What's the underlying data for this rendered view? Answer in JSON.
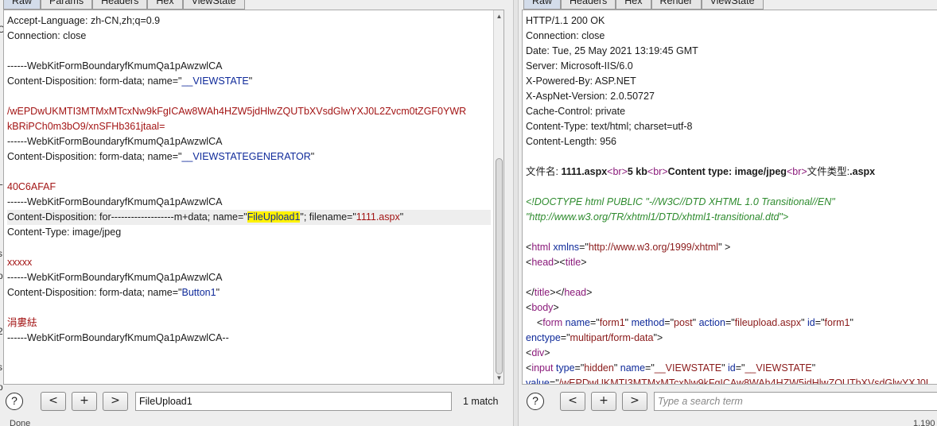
{
  "left": {
    "tabs": [
      "Raw",
      "Params",
      "Headers",
      "Hex",
      "ViewState"
    ],
    "lines": [
      [
        {
          "t": "Accept-Language: zh-CN,zh;q=0.9",
          "c": "k"
        }
      ],
      [
        {
          "t": "Connection: close",
          "c": "k"
        }
      ],
      [],
      [
        {
          "t": "------WebKitFormBoundaryfKmumQa1pAwzwlCA",
          "c": "k"
        }
      ],
      [
        {
          "t": "Content-Disposition: form-data; name=\"",
          "c": "k"
        },
        {
          "t": "__VIEWSTATE",
          "c": "b"
        },
        {
          "t": "\"",
          "c": "k"
        }
      ],
      [],
      [
        {
          "t": "/wEPDwUKMTI3MTMxMTcxNw9kFgICAw8WAh4HZW5jdHlwZQUTbXVsdGlwYXJ0L2Zvcm0tZGF0YWR",
          "c": "v"
        }
      ],
      [
        {
          "t": "kBRiPCh0m3bO9/xnSFHb361jtaal=",
          "c": "v"
        }
      ],
      [
        {
          "t": "------WebKitFormBoundaryfKmumQa1pAwzwlCA",
          "c": "k"
        }
      ],
      [
        {
          "t": "Content-Disposition: form-data; name=\"",
          "c": "k"
        },
        {
          "t": "__VIEWSTATEGENERATOR",
          "c": "b"
        },
        {
          "t": "\"",
          "c": "k"
        }
      ],
      [],
      [
        {
          "t": "40C6AFAF",
          "c": "v"
        }
      ],
      [
        {
          "t": "------WebKitFormBoundaryfKmumQa1pAwzwlCA",
          "c": "k"
        }
      ],
      [
        {
          "t": "Content-Disposition: for-------------------m+data; name=\"",
          "c": "k"
        },
        {
          "t": "FileUpload1",
          "c": "b mark"
        },
        {
          "t": "\"; filename=\"",
          "c": "k"
        },
        {
          "t": "1111.aspx",
          "c": "v"
        },
        {
          "t": "\"",
          "c": "k"
        }
      ],
      [
        {
          "t": "Content-Type: image/jpeg",
          "c": "k"
        }
      ],
      [],
      [
        {
          "t": "xxxxx",
          "c": "v"
        }
      ],
      [
        {
          "t": "------WebKitFormBoundaryfKmumQa1pAwzwlCA",
          "c": "k"
        }
      ],
      [
        {
          "t": "Content-Disposition: form-data; name=\"",
          "c": "k"
        },
        {
          "t": "Button1",
          "c": "b"
        },
        {
          "t": "\"",
          "c": "k"
        }
      ],
      [],
      [
        {
          "t": "涓婁紶",
          "c": "v"
        }
      ],
      [
        {
          "t": "------WebKitFormBoundaryfKmumQa1pAwzwlCA--",
          "c": "k"
        }
      ]
    ],
    "highlight_line": 13,
    "search": {
      "value": "FileUpload1",
      "match_count": "1 match",
      "help": "?",
      "prev": "<",
      "add": "+",
      "next": ">"
    },
    "edge_chars": [
      "C",
      "L",
      "s",
      "p",
      "2",
      "s",
      "p",
      "i"
    ],
    "status": "Done"
  },
  "right": {
    "tabs": [
      "Raw",
      "Headers",
      "Hex",
      "Render",
      "ViewState"
    ],
    "lines": [
      [
        {
          "t": "HTTP/1.1 200 OK",
          "c": "k"
        }
      ],
      [
        {
          "t": "Connection: close",
          "c": "k"
        }
      ],
      [
        {
          "t": "Date: Tue, 25 May 2021 13:19:45 GMT",
          "c": "k"
        }
      ],
      [
        {
          "t": "Server: Microsoft-IIS/6.0",
          "c": "k"
        }
      ],
      [
        {
          "t": "X-Powered-By: ASP.NET",
          "c": "k"
        }
      ],
      [
        {
          "t": "X-AspNet-Version: 2.0.50727",
          "c": "k"
        }
      ],
      [
        {
          "t": "Cache-Control: private",
          "c": "k"
        }
      ],
      [
        {
          "t": "Content-Type: text/html; charset=utf-8",
          "c": "k"
        }
      ],
      [
        {
          "t": "Content-Length: 956",
          "c": "k"
        }
      ],
      [],
      [
        {
          "t": "文件名: ",
          "c": "k"
        },
        {
          "t": "1111.aspx",
          "c": "k bold"
        },
        {
          "t": "<br>",
          "c": "tag"
        },
        {
          "t": "5 kb",
          "c": "k bold"
        },
        {
          "t": "<br>",
          "c": "tag"
        },
        {
          "t": "Content type: image/jpeg",
          "c": "k bold"
        },
        {
          "t": "<br>",
          "c": "tag"
        },
        {
          "t": "文件类型:",
          "c": "k"
        },
        {
          "t": ".aspx",
          "c": "k bold"
        }
      ],
      [],
      [
        {
          "t": "<!DOCTYPE html PUBLIC \"-//W3C//DTD XHTML 1.0 Transitional//EN\"",
          "c": "cmt"
        }
      ],
      [
        {
          "t": "\"http://www.w3.org/TR/xhtml1/DTD/xhtml1-transitional.dtd\">",
          "c": "cmt"
        }
      ],
      [],
      [
        {
          "t": "<",
          "c": "k"
        },
        {
          "t": "html",
          "c": "tag"
        },
        {
          "t": " xmlns",
          "c": "attr"
        },
        {
          "t": "=\"",
          "c": "k"
        },
        {
          "t": "http://www.w3.org/1999/xhtml",
          "c": "str"
        },
        {
          "t": "\" >",
          "c": "k"
        }
      ],
      [
        {
          "t": "<",
          "c": "k"
        },
        {
          "t": "head",
          "c": "tag"
        },
        {
          "t": "><",
          "c": "k"
        },
        {
          "t": "title",
          "c": "tag"
        },
        {
          "t": ">",
          "c": "k"
        }
      ],
      [],
      [
        {
          "t": "</",
          "c": "k"
        },
        {
          "t": "title",
          "c": "tag"
        },
        {
          "t": "></",
          "c": "k"
        },
        {
          "t": "head",
          "c": "tag"
        },
        {
          "t": ">",
          "c": "k"
        }
      ],
      [
        {
          "t": "<",
          "c": "k"
        },
        {
          "t": "body",
          "c": "tag"
        },
        {
          "t": ">",
          "c": "k"
        }
      ],
      [
        {
          "t": "    <",
          "c": "k"
        },
        {
          "t": "form",
          "c": "tag"
        },
        {
          "t": " name",
          "c": "attr"
        },
        {
          "t": "=\"",
          "c": "k"
        },
        {
          "t": "form1",
          "c": "str"
        },
        {
          "t": "\" ",
          "c": "k"
        },
        {
          "t": "method",
          "c": "attr"
        },
        {
          "t": "=\"",
          "c": "k"
        },
        {
          "t": "post",
          "c": "str"
        },
        {
          "t": "\" ",
          "c": "k"
        },
        {
          "t": "action",
          "c": "attr"
        },
        {
          "t": "=\"",
          "c": "k"
        },
        {
          "t": "fileupload.aspx",
          "c": "str"
        },
        {
          "t": "\" ",
          "c": "k"
        },
        {
          "t": "id",
          "c": "attr"
        },
        {
          "t": "=\"",
          "c": "k"
        },
        {
          "t": "form1",
          "c": "str"
        },
        {
          "t": "\"",
          "c": "k"
        }
      ],
      [
        {
          "t": "enctype",
          "c": "attr"
        },
        {
          "t": "=\"",
          "c": "k"
        },
        {
          "t": "multipart/form-data",
          "c": "str"
        },
        {
          "t": "\">",
          "c": "k"
        }
      ],
      [
        {
          "t": "<",
          "c": "k"
        },
        {
          "t": "div",
          "c": "tag"
        },
        {
          "t": ">",
          "c": "k"
        }
      ],
      [
        {
          "t": "<",
          "c": "k"
        },
        {
          "t": "input",
          "c": "tag"
        },
        {
          "t": " type",
          "c": "attr"
        },
        {
          "t": "=\"",
          "c": "k"
        },
        {
          "t": "hidden",
          "c": "str"
        },
        {
          "t": "\" ",
          "c": "k"
        },
        {
          "t": "name",
          "c": "attr"
        },
        {
          "t": "=\"",
          "c": "k"
        },
        {
          "t": "__VIEWSTATE",
          "c": "str"
        },
        {
          "t": "\" ",
          "c": "k"
        },
        {
          "t": "id",
          "c": "attr"
        },
        {
          "t": "=\"",
          "c": "k"
        },
        {
          "t": "__VIEWSTATE",
          "c": "str"
        },
        {
          "t": "\"",
          "c": "k"
        }
      ],
      [
        {
          "t": "value",
          "c": "attr"
        },
        {
          "t": "=\"",
          "c": "k"
        },
        {
          "t": "/wEPDwUKMTI3MTMxMTcxNw9kFgICAw8WAh4HZW5jdHlwZQUTbXVsdGlwYXJ0L",
          "c": "str"
        }
      ]
    ],
    "search": {
      "placeholder": "Type a search term",
      "help": "?",
      "prev": "<",
      "add": "+",
      "next": ">"
    },
    "status": "1,190"
  }
}
